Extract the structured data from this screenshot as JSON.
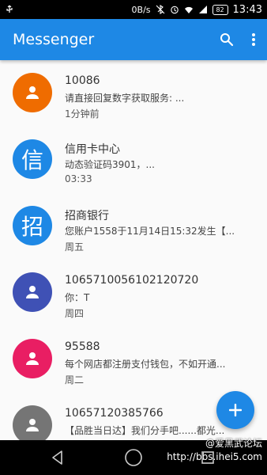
{
  "status_bar": {
    "network_speed": "0B/s",
    "battery": "82",
    "time": "13:43"
  },
  "app_bar": {
    "title": "Messenger",
    "color": "#1e88e5",
    "actions": [
      "search-icon",
      "more-vert-icon"
    ]
  },
  "conversations": [
    {
      "name": "10086",
      "preview": "请直接回复数字获取服务: ...",
      "time": "1分钟前",
      "avatar_type": "person-icon",
      "avatar_char": "",
      "avatar_color": "#ef6c00"
    },
    {
      "name": "信用卡中心",
      "preview": "动态验证码3901，...",
      "time": "03:33",
      "avatar_type": "char",
      "avatar_char": "信",
      "avatar_color": "#1e88e5"
    },
    {
      "name": "招商银行",
      "preview": "您账户1558于11月14日15:32发生【...",
      "time": "周五",
      "avatar_type": "char",
      "avatar_char": "招",
      "avatar_color": "#1e88e5"
    },
    {
      "name": "1065710056102120720",
      "preview": "你：T",
      "time": "周四",
      "avatar_type": "person-icon",
      "avatar_char": "",
      "avatar_color": "#3f51b5"
    },
    {
      "name": "95588",
      "preview": "每个网店都注册支付钱包，不如开通...",
      "time": "周二",
      "avatar_type": "person-icon",
      "avatar_char": "",
      "avatar_color": "#e91e63"
    },
    {
      "name": "10657120385766",
      "preview": "【品胜当日达】我们分手吧......都光...",
      "time": "",
      "avatar_type": "person-icon",
      "avatar_char": "",
      "avatar_color": "#757575"
    }
  ],
  "fab": {
    "icon": "add-icon",
    "color": "#1e88e5"
  },
  "nav_bar": [
    "back-icon",
    "home-icon",
    "recents-icon"
  ],
  "watermark": {
    "line1": "@爱黑武论坛",
    "line2": "http://bbs.ihei5.com"
  }
}
